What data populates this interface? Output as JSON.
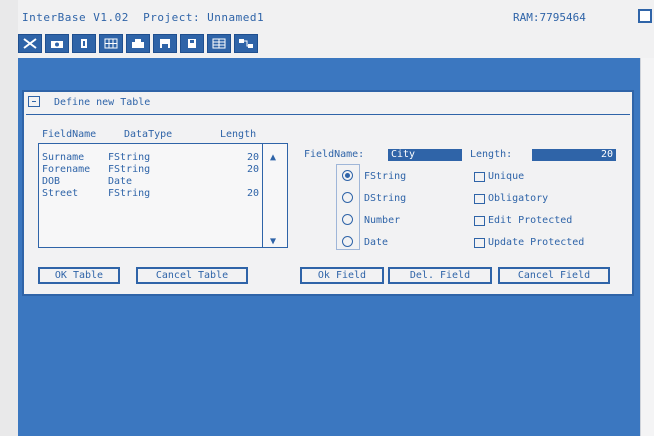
{
  "screen": {
    "title": "InterBase V1.02  Project: Unnamed1",
    "ram": "RAM:7795464"
  },
  "toolbar": {
    "icons": [
      "cut-icon",
      "camera-icon",
      "paint-icon",
      "grid-icon",
      "print-icon",
      "save-icon",
      "floppy-icon",
      "table-icon",
      "diagram-icon"
    ]
  },
  "dialog": {
    "title": "Define new Table",
    "columns": {
      "fieldname": "FieldName",
      "datatype": "DataType",
      "length": "Length"
    },
    "fields": [
      {
        "name": "Surname",
        "type": "FString",
        "length": "20"
      },
      {
        "name": "Forename",
        "type": "FString",
        "length": "20"
      },
      {
        "name": "DOB",
        "type": "Date",
        "length": ""
      },
      {
        "name": "Street",
        "type": "FString",
        "length": "20"
      }
    ],
    "fieldname_label": "FieldName:",
    "fieldname_value": "City",
    "length_label": "Length:",
    "length_value": "20",
    "types": [
      "FString",
      "DString",
      "Number",
      "Date"
    ],
    "selected_type": "FString",
    "options": [
      "Unique",
      "Obligatory",
      "Edit Protected",
      "Update Protected"
    ],
    "buttons": {
      "ok_table": "OK Table",
      "cancel_table": "Cancel Table",
      "ok_field": "Ok Field",
      "del_field": "Del. Field",
      "cancel_field": "Cancel Field"
    }
  },
  "colors": {
    "workspace": "#3b77c0",
    "accent": "#2f64a8",
    "panel": "#f2f2f3"
  }
}
